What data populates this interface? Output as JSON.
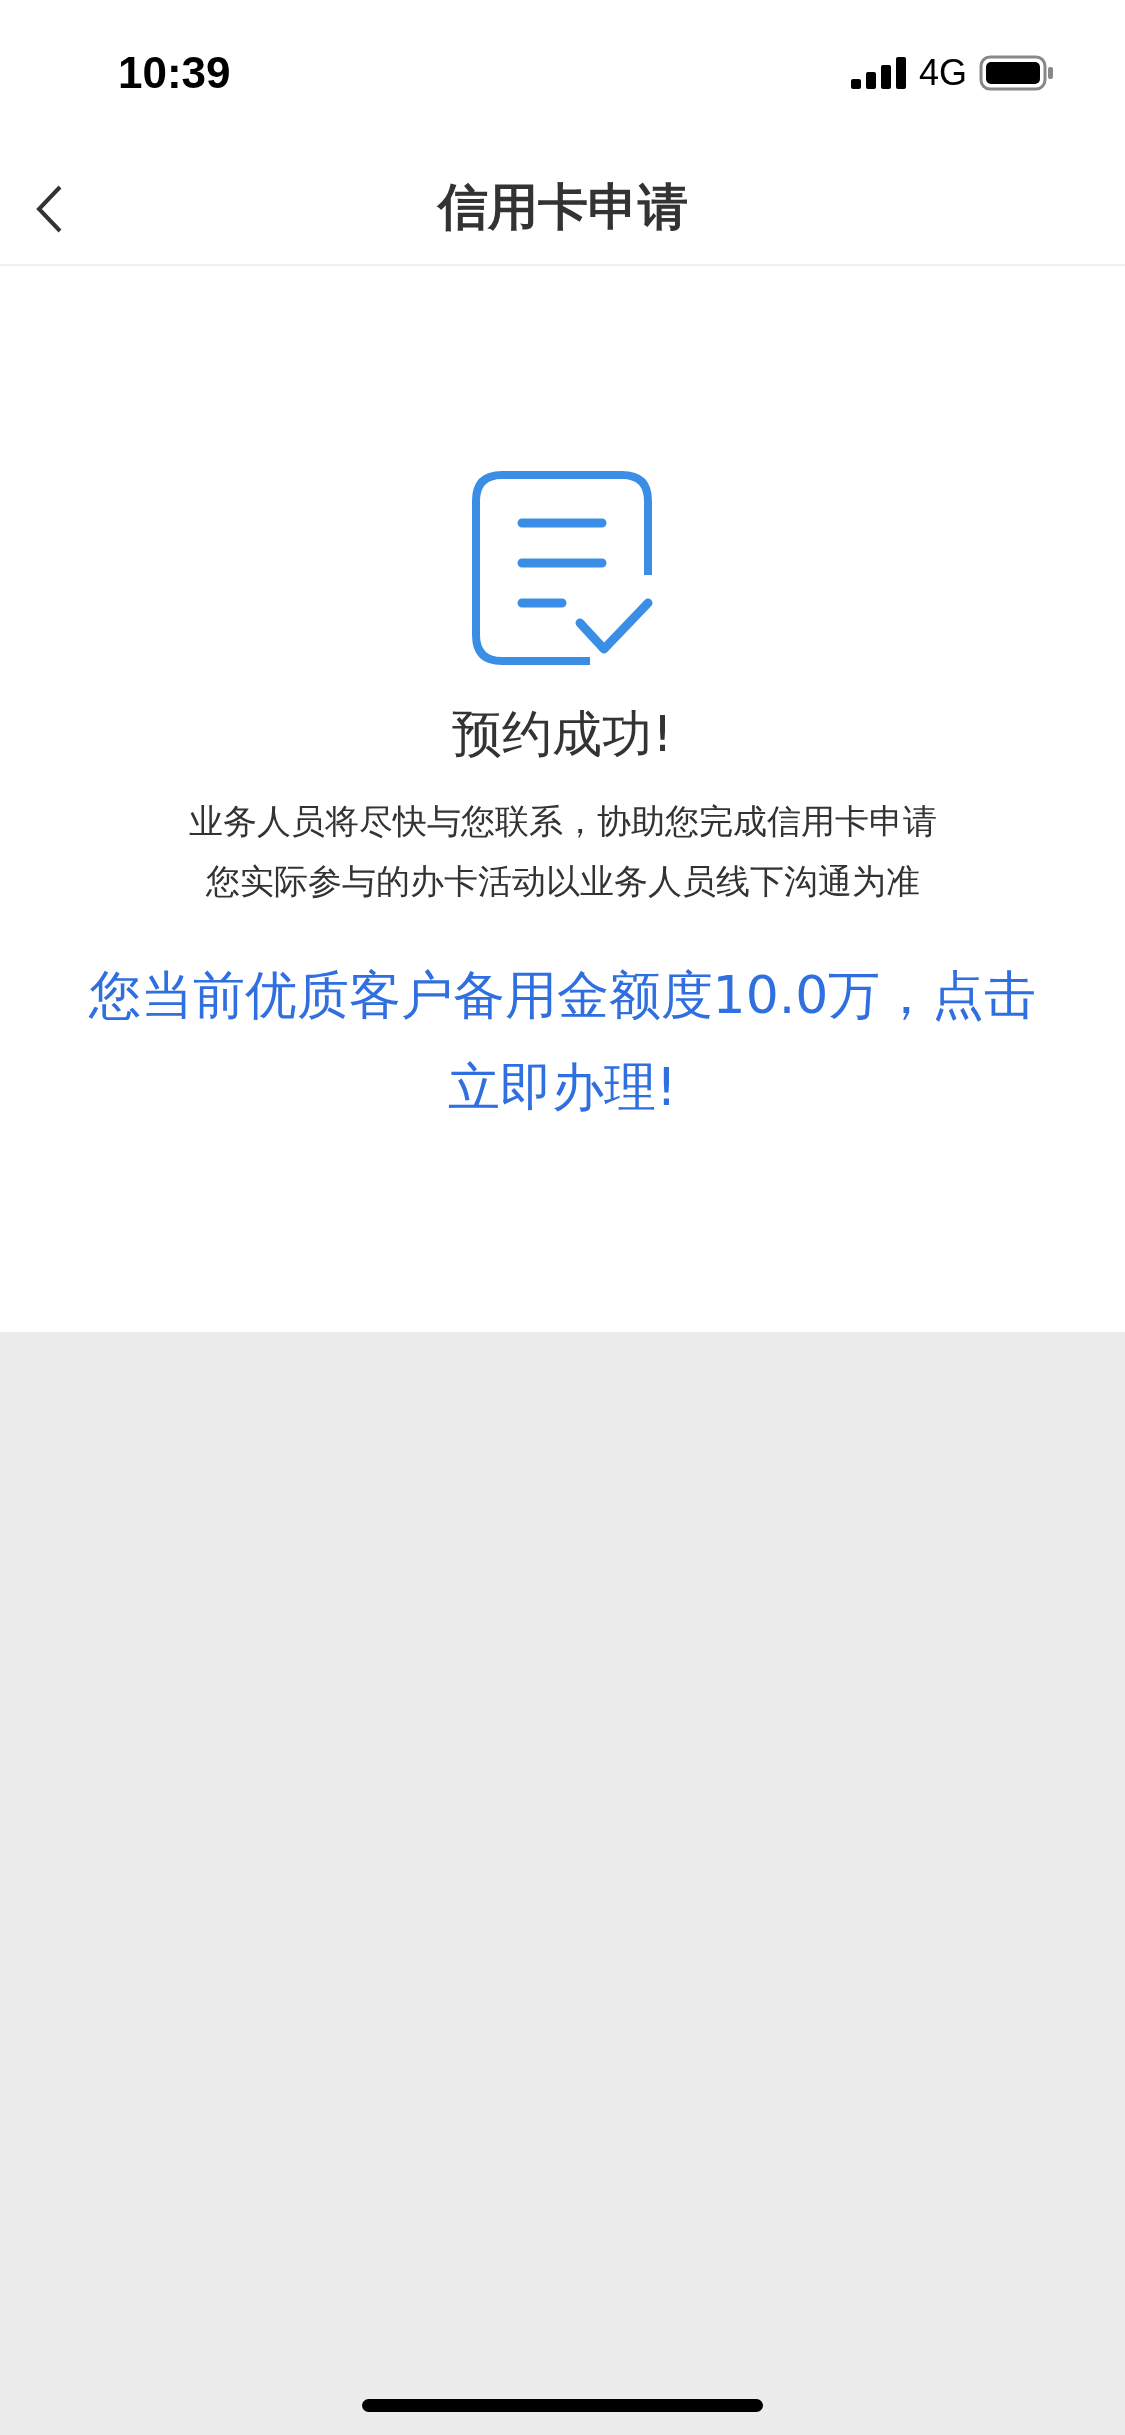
{
  "status_bar": {
    "time": "10:39",
    "network": "4G"
  },
  "nav_bar": {
    "title": "信用卡申请"
  },
  "result": {
    "title": "预约成功!",
    "messages": [
      "业务人员将尽快与您联系，协助您完成信用卡申请",
      "您实际参与的办卡活动以业务人员线下沟通为准"
    ],
    "offer": "您当前优质客户备用金额度10.0万，点击立即办理!"
  }
}
